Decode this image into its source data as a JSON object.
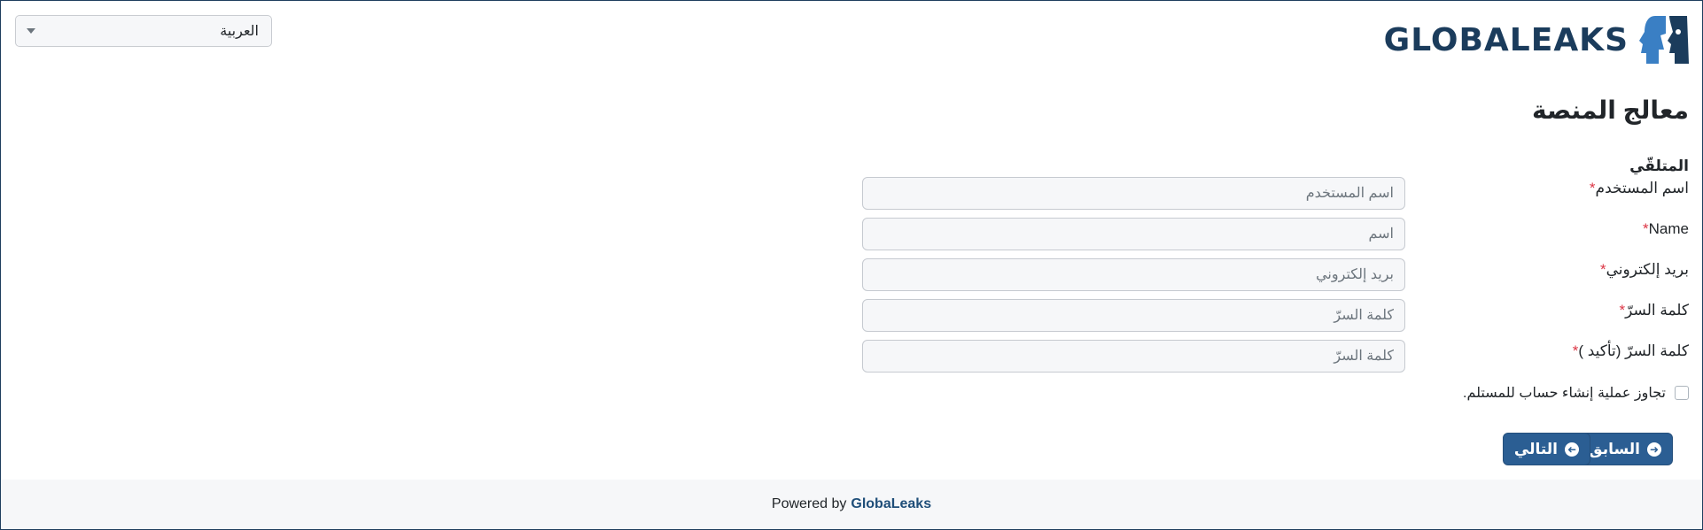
{
  "language_select": {
    "value": "العربية"
  },
  "brand": {
    "logo_text": "GLOBALEAKS",
    "color": "#1b3c5c",
    "accent": "#3a7fc4"
  },
  "page": {
    "title": "معالج المنصة",
    "section_heading": "المتلقّي"
  },
  "form": {
    "fields": [
      {
        "label": "اسم المستخدم",
        "required": "*",
        "placeholder": "اسم المستخدم"
      },
      {
        "label": "Name",
        "required": "*",
        "placeholder": "اسم"
      },
      {
        "label": "بريد إلكتروني",
        "required": "*",
        "placeholder": "بريد إلكتروني"
      },
      {
        "label": "كلمة السرّ",
        "required": "*",
        "placeholder": "كلمة السرّ"
      },
      {
        "label": "كلمة السرّ (تأكيد )",
        "required": "*",
        "placeholder": "كلمة السرّ"
      }
    ],
    "skip_checkbox_label": "تجاوز عملية إنشاء حساب للمستلم.",
    "skip_checked": false
  },
  "buttons": {
    "previous_label": "السابق",
    "next_label": "التالي",
    "primary_color": "#2b5e93"
  },
  "footer": {
    "powered_by": "Powered by",
    "brand_link": "GlobaLeaks"
  }
}
